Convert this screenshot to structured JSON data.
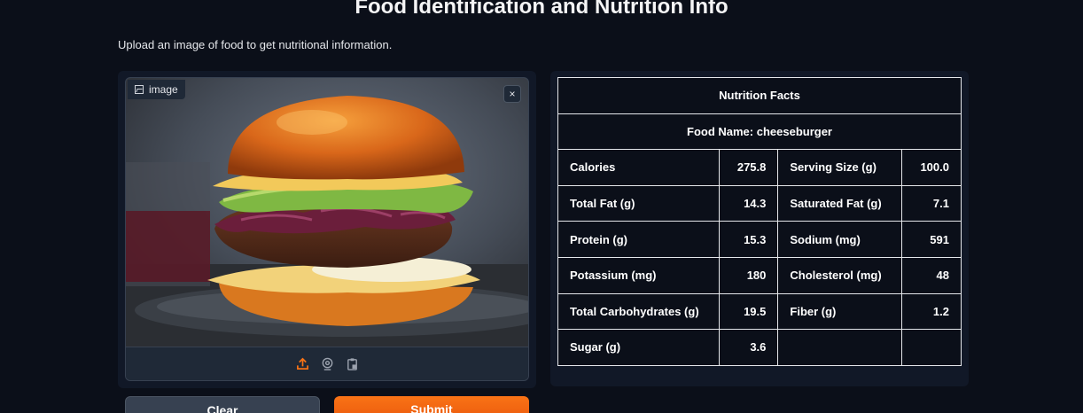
{
  "header": {
    "title": "Food Identification and Nutrition Info",
    "subtitle": "Upload an image of food to get nutritional information."
  },
  "image_input": {
    "label": "image",
    "close_label": "×",
    "toolbar_icons": [
      "upload-icon",
      "webcam-icon",
      "clipboard-icon"
    ]
  },
  "buttons": {
    "clear_label": "Clear",
    "submit_label": "Submit"
  },
  "nutrition": {
    "title": "Nutrition Facts",
    "food_name": "Food Name: cheeseburger",
    "rows": [
      {
        "l1": "Calories",
        "v1": "275.8",
        "l2": "Serving Size (g)",
        "v2": "100.0"
      },
      {
        "l1": "Total Fat (g)",
        "v1": "14.3",
        "l2": "Saturated Fat (g)",
        "v2": "7.1"
      },
      {
        "l1": "Protein (g)",
        "v1": "15.3",
        "l2": "Sodium (mg)",
        "v2": "591"
      },
      {
        "l1": "Potassium (mg)",
        "v1": "180",
        "l2": "Cholesterol (mg)",
        "v2": "48"
      },
      {
        "l1": "Total Carbohydrates (g)",
        "v1": "19.5",
        "l2": "Fiber (g)",
        "v2": "1.2"
      },
      {
        "l1": "Sugar (g)",
        "v1": "3.6",
        "l2": "",
        "v2": ""
      }
    ]
  },
  "colors": {
    "background": "#0b0f19",
    "panel": "#111827",
    "accent": "#f97316"
  }
}
